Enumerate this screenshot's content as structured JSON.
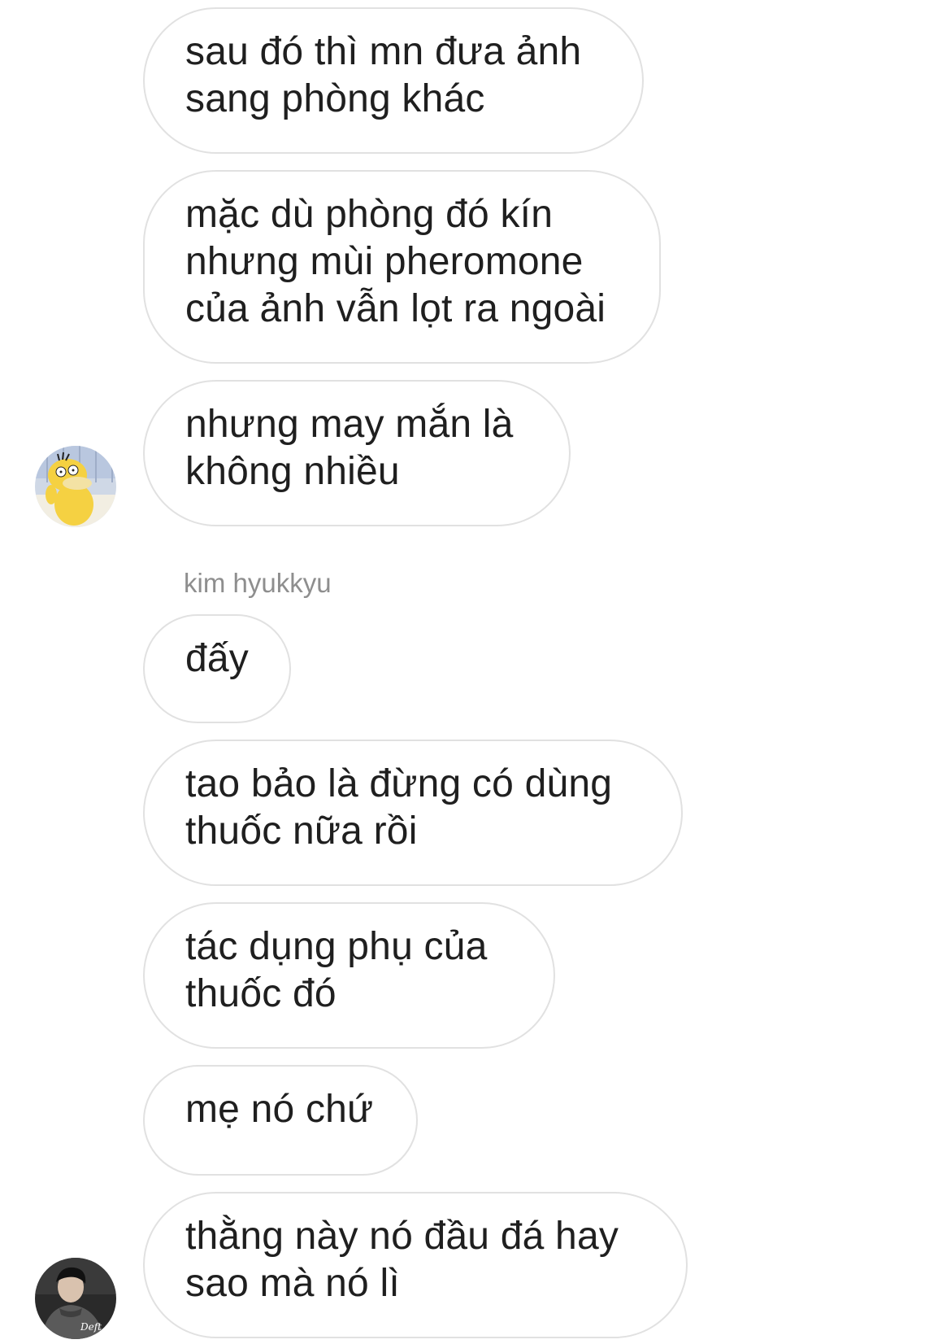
{
  "conversation": {
    "group_a": {
      "messages": [
        "sau đó thì mn đưa ảnh\nsang phòng khác",
        "mặc dù phòng đó kín\nnhưng mùi pheromone\ncủa ảnh vẫn lọt ra ngoài",
        "nhưng may mắn là\nkhông nhiều"
      ],
      "avatar_icon": "psyduck-avatar"
    },
    "group_b": {
      "sender_name": "kim hyukkyu",
      "messages": [
        "đấy",
        "tao bảo là đừng có dùng\nthuốc nữa rồi",
        "tác dụng phụ của\nthuốc đó",
        "mẹ nó chứ",
        "thằng này nó đầu đá hay\nsao mà nó lì"
      ],
      "avatar_icon": "person-avatar",
      "avatar_watermark": "Deft"
    }
  },
  "colors": {
    "bubble_border": "#e1e1e1",
    "text": "#1f1f1f",
    "sender_name": "#8e8e8e"
  }
}
